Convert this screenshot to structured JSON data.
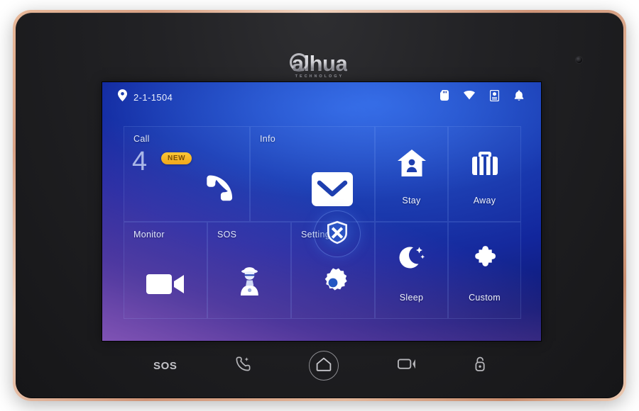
{
  "device": {
    "brand_name": "alhua",
    "brand_sub": "TECHNOLOGY",
    "bezel_color": "#d9a184",
    "body_color": "#1d1d20"
  },
  "screen": {
    "status_bar": {
      "location_icon": "map-pin-icon",
      "location_text": "2-1-1504",
      "icons": [
        {
          "name": "sd-card-icon",
          "label": "SD Card"
        },
        {
          "name": "wifi-icon",
          "label": "Wi-Fi"
        },
        {
          "name": "storage-icon",
          "label": "Storage"
        },
        {
          "name": "bell-icon",
          "label": "Notifications"
        }
      ]
    },
    "tiles": [
      {
        "id": "call",
        "label": "Call",
        "icon": "phone-icon",
        "count": "4",
        "badge": "NEW",
        "badge_color": "#f0a81c",
        "label_pos": "top"
      },
      {
        "id": "info",
        "label": "Info",
        "icon": "mail-icon",
        "label_pos": "top"
      },
      {
        "id": "stay",
        "label": "Stay",
        "icon": "home-person-icon",
        "label_pos": "bottom"
      },
      {
        "id": "away",
        "label": "Away",
        "icon": "briefcase-icon",
        "label_pos": "bottom"
      },
      {
        "id": "monitor",
        "label": "Monitor",
        "icon": "video-camera-icon",
        "label_pos": "top"
      },
      {
        "id": "sos",
        "label": "SOS",
        "icon": "guard-icon",
        "label_pos": "top"
      },
      {
        "id": "setting",
        "label": "Setting",
        "icon": "gear-icon",
        "label_pos": "top"
      },
      {
        "id": "sleep",
        "label": "Sleep",
        "icon": "moon-icon",
        "label_pos": "bottom"
      },
      {
        "id": "custom",
        "label": "Custom",
        "icon": "puzzle-icon",
        "label_pos": "bottom"
      }
    ],
    "center_button": {
      "name": "shield-disarm-button",
      "icon": "shield-x-icon"
    }
  },
  "hardware_keys": [
    {
      "name": "sos-key",
      "label": "SOS",
      "type": "text"
    },
    {
      "name": "call-key",
      "label": "",
      "icon": "phone-call-icon"
    },
    {
      "name": "home-key",
      "label": "",
      "icon": "home-icon"
    },
    {
      "name": "monitor-key",
      "label": "",
      "icon": "camera-icon"
    },
    {
      "name": "unlock-key",
      "label": "",
      "icon": "unlock-icon"
    }
  ]
}
